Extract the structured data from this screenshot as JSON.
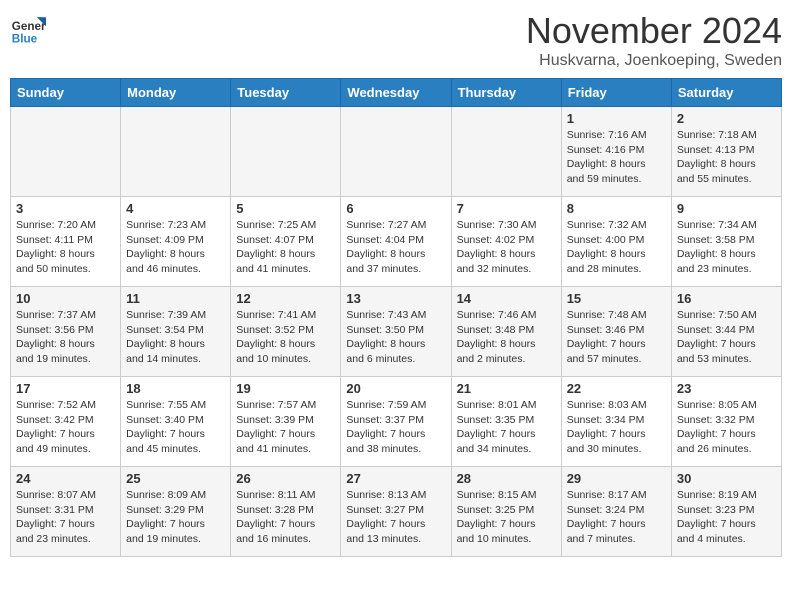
{
  "header": {
    "logo_text_line1": "General",
    "logo_text_line2": "Blue",
    "month": "November 2024",
    "location": "Huskvarna, Joenkoeping, Sweden"
  },
  "weekdays": [
    "Sunday",
    "Monday",
    "Tuesday",
    "Wednesday",
    "Thursday",
    "Friday",
    "Saturday"
  ],
  "weeks": [
    [
      {
        "day": "",
        "info": ""
      },
      {
        "day": "",
        "info": ""
      },
      {
        "day": "",
        "info": ""
      },
      {
        "day": "",
        "info": ""
      },
      {
        "day": "",
        "info": ""
      },
      {
        "day": "1",
        "info": "Sunrise: 7:16 AM\nSunset: 4:16 PM\nDaylight: 8 hours\nand 59 minutes."
      },
      {
        "day": "2",
        "info": "Sunrise: 7:18 AM\nSunset: 4:13 PM\nDaylight: 8 hours\nand 55 minutes."
      }
    ],
    [
      {
        "day": "3",
        "info": "Sunrise: 7:20 AM\nSunset: 4:11 PM\nDaylight: 8 hours\nand 50 minutes."
      },
      {
        "day": "4",
        "info": "Sunrise: 7:23 AM\nSunset: 4:09 PM\nDaylight: 8 hours\nand 46 minutes."
      },
      {
        "day": "5",
        "info": "Sunrise: 7:25 AM\nSunset: 4:07 PM\nDaylight: 8 hours\nand 41 minutes."
      },
      {
        "day": "6",
        "info": "Sunrise: 7:27 AM\nSunset: 4:04 PM\nDaylight: 8 hours\nand 37 minutes."
      },
      {
        "day": "7",
        "info": "Sunrise: 7:30 AM\nSunset: 4:02 PM\nDaylight: 8 hours\nand 32 minutes."
      },
      {
        "day": "8",
        "info": "Sunrise: 7:32 AM\nSunset: 4:00 PM\nDaylight: 8 hours\nand 28 minutes."
      },
      {
        "day": "9",
        "info": "Sunrise: 7:34 AM\nSunset: 3:58 PM\nDaylight: 8 hours\nand 23 minutes."
      }
    ],
    [
      {
        "day": "10",
        "info": "Sunrise: 7:37 AM\nSunset: 3:56 PM\nDaylight: 8 hours\nand 19 minutes."
      },
      {
        "day": "11",
        "info": "Sunrise: 7:39 AM\nSunset: 3:54 PM\nDaylight: 8 hours\nand 14 minutes."
      },
      {
        "day": "12",
        "info": "Sunrise: 7:41 AM\nSunset: 3:52 PM\nDaylight: 8 hours\nand 10 minutes."
      },
      {
        "day": "13",
        "info": "Sunrise: 7:43 AM\nSunset: 3:50 PM\nDaylight: 8 hours\nand 6 minutes."
      },
      {
        "day": "14",
        "info": "Sunrise: 7:46 AM\nSunset: 3:48 PM\nDaylight: 8 hours\nand 2 minutes."
      },
      {
        "day": "15",
        "info": "Sunrise: 7:48 AM\nSunset: 3:46 PM\nDaylight: 7 hours\nand 57 minutes."
      },
      {
        "day": "16",
        "info": "Sunrise: 7:50 AM\nSunset: 3:44 PM\nDaylight: 7 hours\nand 53 minutes."
      }
    ],
    [
      {
        "day": "17",
        "info": "Sunrise: 7:52 AM\nSunset: 3:42 PM\nDaylight: 7 hours\nand 49 minutes."
      },
      {
        "day": "18",
        "info": "Sunrise: 7:55 AM\nSunset: 3:40 PM\nDaylight: 7 hours\nand 45 minutes."
      },
      {
        "day": "19",
        "info": "Sunrise: 7:57 AM\nSunset: 3:39 PM\nDaylight: 7 hours\nand 41 minutes."
      },
      {
        "day": "20",
        "info": "Sunrise: 7:59 AM\nSunset: 3:37 PM\nDaylight: 7 hours\nand 38 minutes."
      },
      {
        "day": "21",
        "info": "Sunrise: 8:01 AM\nSunset: 3:35 PM\nDaylight: 7 hours\nand 34 minutes."
      },
      {
        "day": "22",
        "info": "Sunrise: 8:03 AM\nSunset: 3:34 PM\nDaylight: 7 hours\nand 30 minutes."
      },
      {
        "day": "23",
        "info": "Sunrise: 8:05 AM\nSunset: 3:32 PM\nDaylight: 7 hours\nand 26 minutes."
      }
    ],
    [
      {
        "day": "24",
        "info": "Sunrise: 8:07 AM\nSunset: 3:31 PM\nDaylight: 7 hours\nand 23 minutes."
      },
      {
        "day": "25",
        "info": "Sunrise: 8:09 AM\nSunset: 3:29 PM\nDaylight: 7 hours\nand 19 minutes."
      },
      {
        "day": "26",
        "info": "Sunrise: 8:11 AM\nSunset: 3:28 PM\nDaylight: 7 hours\nand 16 minutes."
      },
      {
        "day": "27",
        "info": "Sunrise: 8:13 AM\nSunset: 3:27 PM\nDaylight: 7 hours\nand 13 minutes."
      },
      {
        "day": "28",
        "info": "Sunrise: 8:15 AM\nSunset: 3:25 PM\nDaylight: 7 hours\nand 10 minutes."
      },
      {
        "day": "29",
        "info": "Sunrise: 8:17 AM\nSunset: 3:24 PM\nDaylight: 7 hours\nand 7 minutes."
      },
      {
        "day": "30",
        "info": "Sunrise: 8:19 AM\nSunset: 3:23 PM\nDaylight: 7 hours\nand 4 minutes."
      }
    ]
  ]
}
